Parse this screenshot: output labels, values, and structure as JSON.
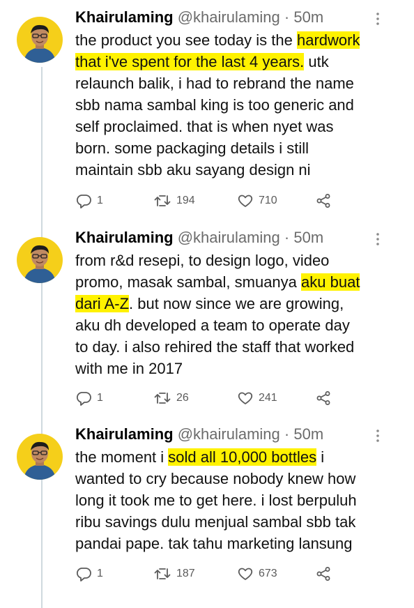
{
  "tweets": [
    {
      "name": "Khairulaming",
      "handle": "@khairulaming",
      "sep": "·",
      "time": "50m",
      "lines": [
        [
          {
            "t": "the product you see today is the "
          },
          {
            "t": "hardwork",
            "h": true
          }
        ],
        [
          {
            "t": "that i've spent for the last 4 years.",
            "h": true
          },
          {
            "t": " utk"
          }
        ],
        [
          {
            "t": "relaunch balik, i had to rebrand the name"
          }
        ],
        [
          {
            "t": "sbb nama sambal king is too generic and"
          }
        ],
        [
          {
            "t": "self proclaimed. that is when nyet was"
          }
        ],
        [
          {
            "t": "born. some packaging details i still"
          }
        ],
        [
          {
            "t": "maintain sbb aku sayang design ni"
          }
        ]
      ],
      "replies": "1",
      "retweets": "194",
      "likes": "710"
    },
    {
      "name": "Khairulaming",
      "handle": "@khairulaming",
      "sep": "·",
      "time": "50m",
      "lines": [
        [
          {
            "t": "from r&d resepi, to design logo, video"
          }
        ],
        [
          {
            "t": "promo, masak sambal, smuanya "
          },
          {
            "t": "aku buat",
            "h": true
          }
        ],
        [
          {
            "t": "dari A-Z",
            "h": true
          },
          {
            "t": ". but now since we are growing,"
          }
        ],
        [
          {
            "t": "aku dh developed a team to operate day"
          }
        ],
        [
          {
            "t": "to day. i also rehired the staff that worked"
          }
        ],
        [
          {
            "t": "with me in 2017"
          }
        ]
      ],
      "replies": "1",
      "retweets": "26",
      "likes": "241"
    },
    {
      "name": "Khairulaming",
      "handle": "@khairulaming",
      "sep": "·",
      "time": "50m",
      "lines": [
        [
          {
            "t": "the moment i "
          },
          {
            "t": "sold all 10,000 bottles",
            "h": true
          },
          {
            "t": " i"
          }
        ],
        [
          {
            "t": "wanted to cry because nobody knew how"
          }
        ],
        [
          {
            "t": "long it took me to get here. i lost berpuluh"
          }
        ],
        [
          {
            "t": "ribu savings dulu menjual sambal sbb tak"
          }
        ],
        [
          {
            "t": "pandai pape. tak tahu marketing lansung"
          }
        ]
      ],
      "replies": "1",
      "retweets": "187",
      "likes": "673"
    }
  ],
  "icons": {
    "reply": "reply-icon",
    "retweet": "retweet-icon",
    "like": "heart-icon",
    "share": "share-icon",
    "more": "more-options-icon"
  },
  "colors": {
    "highlight": "#fff200",
    "avatar_bg": "#f5cf1a",
    "secondary_text": "#6b6b6b"
  }
}
